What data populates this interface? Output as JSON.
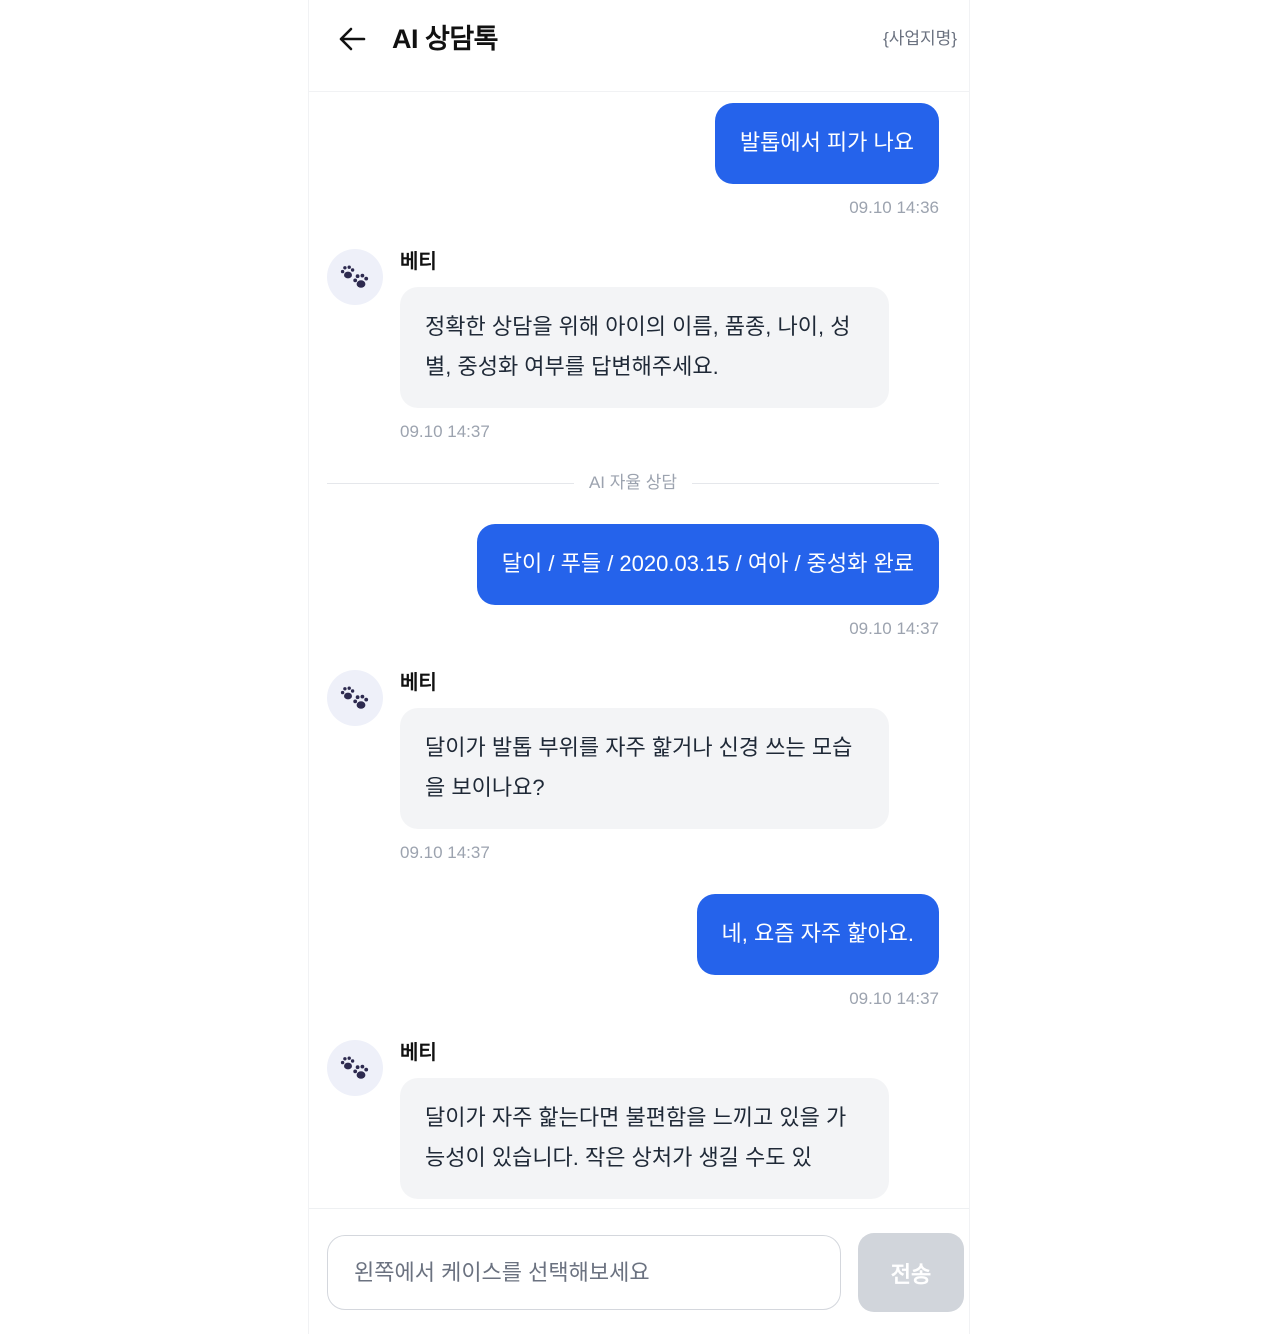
{
  "header": {
    "back_icon": "arrow-left-icon",
    "title": "AI 상담톡",
    "business_name": "{사업지명}"
  },
  "chat": {
    "messages": [
      {
        "text": "발톱에서 피가 나요",
        "time": "09.10 14:36"
      },
      {
        "sender": "베티",
        "avatar_icon": "paw-icon",
        "text": "정확한 상담을 위해 아이의 이름, 품종, 나이, 성별, 중성화 여부를 답변해주세요.",
        "time": "09.10 14:37"
      },
      {
        "text": "달이 / 푸들 / 2020.03.15 / 여아 / 중성화 완료",
        "time": "09.10 14:37"
      },
      {
        "sender": "베티",
        "avatar_icon": "paw-icon",
        "text": "달이가 발톱 부위를 자주 핥거나 신경 쓰는 모습을 보이나요?",
        "time": "09.10 14:37"
      },
      {
        "text": "네, 요즘 자주 핥아요.",
        "time": "09.10 14:37"
      },
      {
        "sender": "베티",
        "avatar_icon": "paw-icon",
        "text": "달이가 자주 핥는다면 불편함을 느끼고 있을 가능성이 있습니다. 작은 상처가 생길 수도 있"
      }
    ],
    "divider_label": "AI 자율 상담"
  },
  "composer": {
    "placeholder": "왼쪽에서 케이스를 선택해보세요",
    "send_label": "전송"
  },
  "colors": {
    "user_bubble": "#2563eb",
    "bot_bubble": "#f3f4f6",
    "avatar_bg": "#eef0f9",
    "paw": "#2d2a4f",
    "timestamp": "#9ca3af",
    "send_disabled": "#d1d5db"
  }
}
